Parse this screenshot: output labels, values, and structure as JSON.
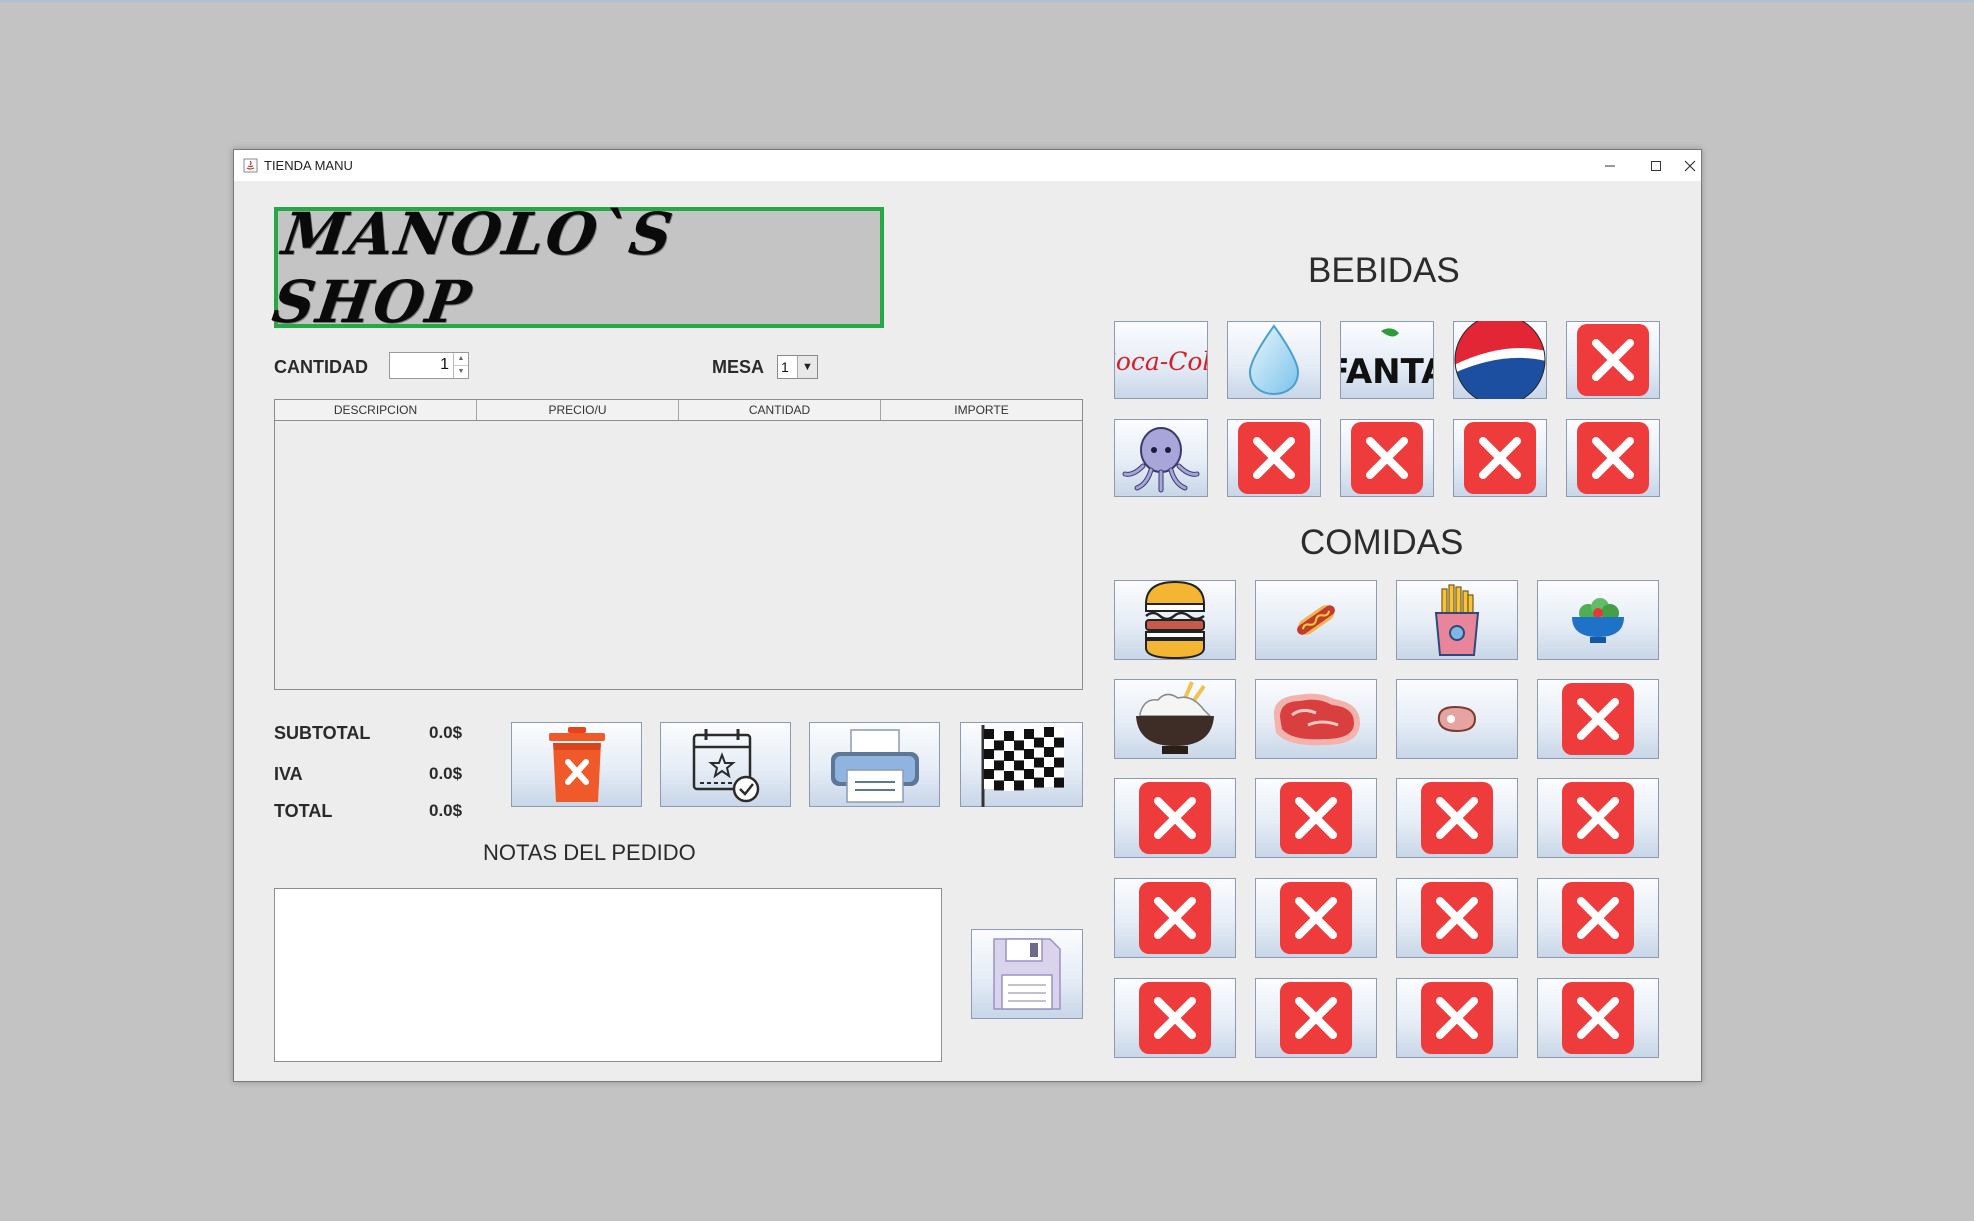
{
  "window": {
    "title": "TIENDA MANU"
  },
  "logo": {
    "text": "MANOLO`S SHOP"
  },
  "controls": {
    "cantidad_label": "CANTIDAD",
    "cantidad_value": "1",
    "mesa_label": "MESA",
    "mesa_value": "1"
  },
  "table": {
    "columns": [
      "DESCRIPCION",
      "PRECIO/U",
      "CANTIDAD",
      "IMPORTE"
    ],
    "rows": []
  },
  "totals": {
    "subtotal_label": "SUBTOTAL",
    "subtotal_value": "0.0$",
    "iva_label": "IVA",
    "iva_value": "0.0$",
    "total_label": "TOTAL",
    "total_value": "0.0$"
  },
  "actions": [
    "trash-icon",
    "calendar-icon",
    "printer-icon",
    "checkered-flag-icon"
  ],
  "notes": {
    "title": "NOTAS DEL PEDIDO",
    "value": ""
  },
  "save": {
    "icon": "floppy-disk-icon"
  },
  "bebidas": {
    "title": "BEBIDAS",
    "items": [
      "coca-cola-icon",
      "water-drop-icon",
      "fanta-icon",
      "pepsi-icon",
      "red-x-icon",
      "octopus-icon",
      "red-x-icon",
      "red-x-icon",
      "red-x-icon",
      "red-x-icon"
    ],
    "text": {
      "coca_cola": "Coca-Cola",
      "fanta": "FANTA"
    }
  },
  "comidas": {
    "title": "COMIDAS",
    "items": [
      "burger-icon",
      "hotdog-icon",
      "fries-icon",
      "salad-bowl-icon",
      "rice-bowl-icon",
      "steak-icon",
      "ham-icon",
      "red-x-icon",
      "red-x-icon",
      "red-x-icon",
      "red-x-icon",
      "red-x-icon",
      "red-x-icon",
      "red-x-icon",
      "red-x-icon",
      "red-x-icon",
      "red-x-icon",
      "red-x-icon",
      "red-x-icon",
      "red-x-icon"
    ]
  },
  "colors": {
    "accent_green": "#25a845",
    "x_red": "#ee3b3b",
    "window_bg": "#ededed",
    "desktop_bg": "#c3c3c3"
  }
}
